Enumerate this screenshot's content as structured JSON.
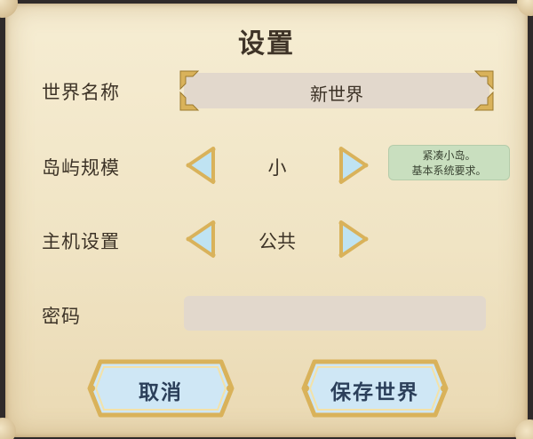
{
  "title": "设置",
  "rows": {
    "world_name": {
      "label": "世界名称",
      "value": "新世界"
    },
    "island_size": {
      "label": "岛屿规模",
      "value": "小",
      "tooltip": [
        "紧凑小岛。",
        "基本系统要求。"
      ]
    },
    "host_settings": {
      "label": "主机设置",
      "value": "公共"
    },
    "password": {
      "label": "密码",
      "value": ""
    }
  },
  "buttons": {
    "cancel": "取消",
    "save": "保存世界"
  },
  "colors": {
    "parchment": "#f0e4c4",
    "field": "#e2d8cc",
    "tooltip": "#c9dfbf",
    "gold": "#d9b25a",
    "arrow_fill": "#bfe3f2",
    "button_fill": "#cfe7f5",
    "text": "#3d3327"
  },
  "icons": [
    "arrow-left-icon",
    "arrow-right-icon",
    "gold-corner-icon"
  ]
}
